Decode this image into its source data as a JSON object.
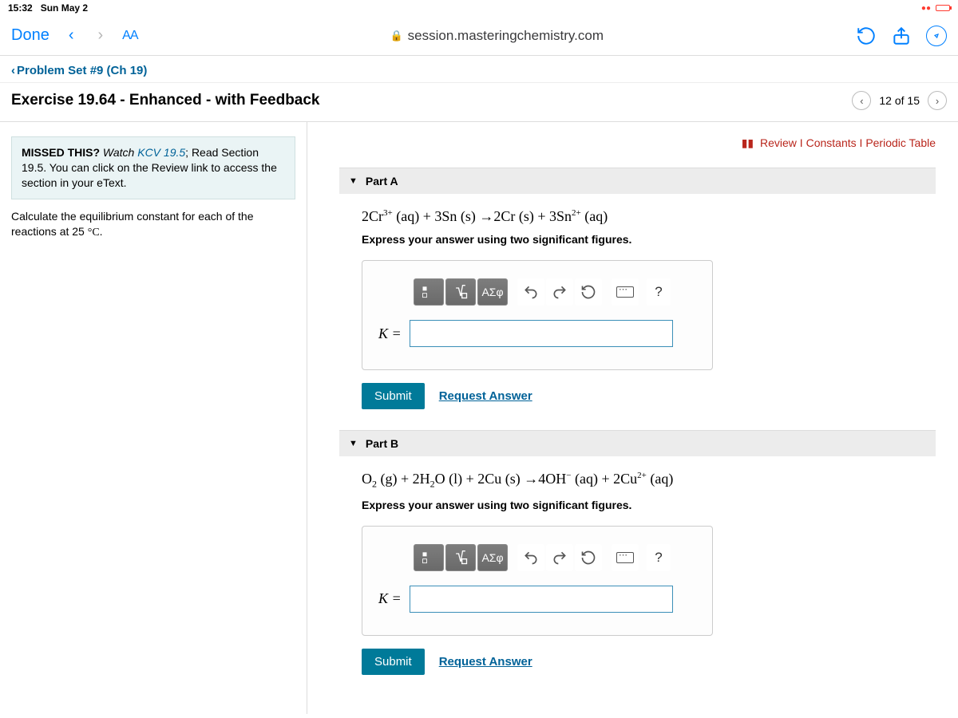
{
  "status": {
    "time": "15:32",
    "date": "Sun May 2"
  },
  "browser": {
    "done": "Done",
    "aa": "AA",
    "url": "session.masteringchemistry.com"
  },
  "breadcrumb": "Problem Set #9 (Ch 19)",
  "exercise_title": "Exercise 19.64 - Enhanced - with Feedback",
  "position": "12 of 15",
  "top_links": {
    "review": "Review",
    "constants": "Constants",
    "periodic": "Periodic Table"
  },
  "hint": {
    "lead": "MISSED THIS?",
    "watch": "Watch",
    "kcv": "KCV 19.5",
    "read": "; Read Section 19.5. You can click on the Review link to access the section in your eText."
  },
  "prompt": {
    "line1": "Calculate the equilibrium constant for each of the reactions at 25",
    "deg": "°C",
    "dot": "."
  },
  "parts": {
    "a": {
      "label": "Part A",
      "equation_html": "2Cr<sup>3+</sup> (aq) + 3Sn (s) →2Cr (s) + 3Sn<sup>2+</sup> (aq)",
      "instr": "Express your answer using two significant figures.",
      "k": "K =",
      "submit": "Submit",
      "request": "Request Answer"
    },
    "b": {
      "label": "Part B",
      "equation_html": "O<sub>2</sub> (g) + 2H<sub>2</sub>O (l) + 2Cu (s) →4OH<sup>−</sup> (aq) + 2Cu<sup>2+</sup> (aq)",
      "instr": "Express your answer using two significant figures.",
      "k": "K =",
      "submit": "Submit",
      "request": "Request Answer"
    }
  },
  "toolbar": {
    "greek": "ΑΣφ",
    "help": "?"
  }
}
